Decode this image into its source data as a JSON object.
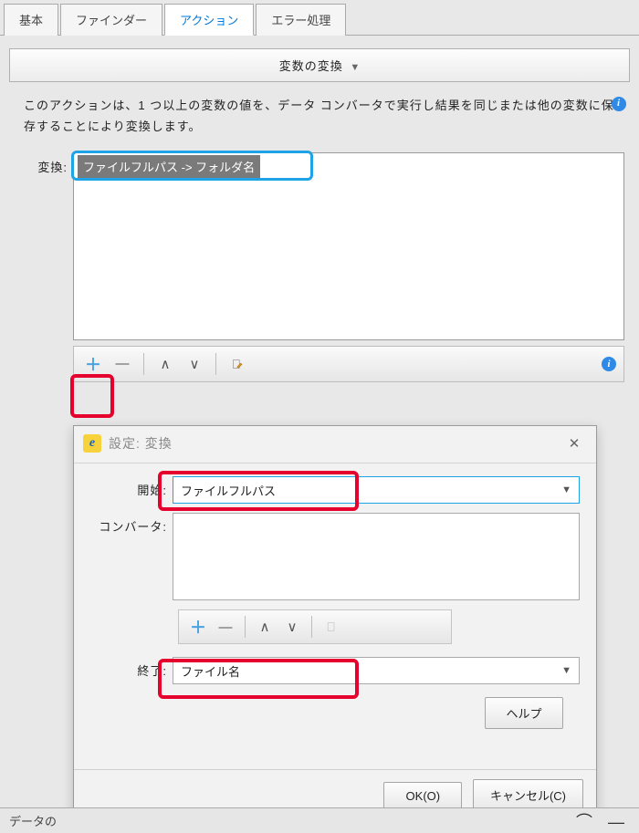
{
  "tabs": {
    "basic": "基本",
    "finder": "ファインダー",
    "action": "アクション",
    "error": "エラー処理"
  },
  "bar": {
    "title": "変数の変換",
    "chev": "▼"
  },
  "description": "このアクションは、1 つ以上の変数の値を、データ コンバータで実行し結果を同じまたは他の変数に保存することにより変換します。",
  "help_glyph": "i",
  "form": {
    "convert_label": "変換:",
    "item1": "ファイルフルパス -> フォルダ名"
  },
  "toolbar_icons": {
    "add": "＋",
    "remove": "—",
    "up": "∧",
    "down": "∨"
  },
  "dialog": {
    "title": "設定: 変換",
    "close": "✕",
    "start_label": "開始:",
    "start_value": "ファイルフルパス",
    "converter_label": "コンバータ:",
    "end_label": "終了:",
    "end_value": "ファイル名",
    "help_btn": "ヘルプ",
    "ok_btn": "OK(O)",
    "cancel_btn": "キャンセル(C)"
  },
  "bottom": {
    "text": "データの"
  }
}
